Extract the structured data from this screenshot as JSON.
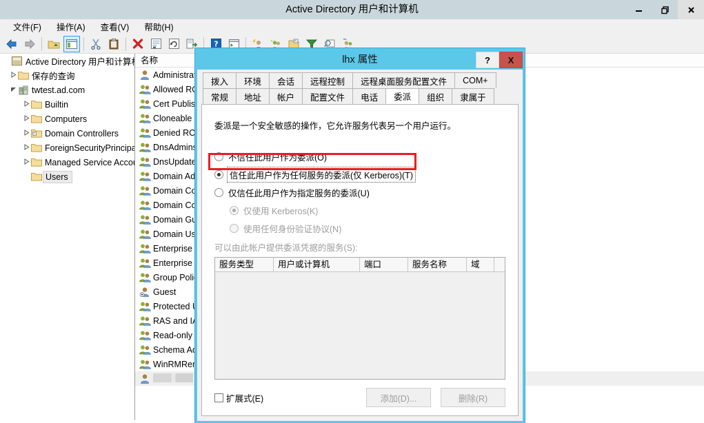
{
  "window": {
    "title": "Active Directory 用户和计算机",
    "controls": {
      "minimize": "minimize-icon",
      "restore": "restore-icon",
      "close": "close-icon"
    }
  },
  "menu": {
    "items": [
      "文件(F)",
      "操作(A)",
      "查看(V)",
      "帮助(H)"
    ]
  },
  "toolbar": {
    "buttons": [
      "back-arrow-icon",
      "forward-arrow-icon",
      "up-folder-icon",
      "show-hide-tree-icon",
      "cut-icon",
      "paste-icon",
      "delete-icon",
      "properties-icon",
      "refresh-icon",
      "export-list-icon",
      "help-icon",
      "run-console-icon",
      "new-user-icon",
      "new-group-icon",
      "new-ou-icon",
      "filter-icon",
      "find-icon",
      "add-member-icon"
    ]
  },
  "tree": {
    "items": [
      {
        "label": "Active Directory 用户和计算机",
        "icon": "console-root-icon",
        "indent": 0,
        "arrow": "",
        "selected": false
      },
      {
        "label": "保存的查询",
        "icon": "folder-icon",
        "indent": 1,
        "arrow": "collapsed",
        "selected": false
      },
      {
        "label": "twtest.ad.com",
        "icon": "domain-icon",
        "indent": 1,
        "arrow": "expanded",
        "selected": false
      },
      {
        "label": "Builtin",
        "icon": "folder-icon",
        "indent": 2,
        "arrow": "collapsed",
        "selected": false
      },
      {
        "label": "Computers",
        "icon": "folder-icon",
        "indent": 2,
        "arrow": "collapsed",
        "selected": false
      },
      {
        "label": "Domain Controllers",
        "icon": "ou-folder-icon",
        "indent": 2,
        "arrow": "collapsed",
        "selected": false
      },
      {
        "label": "ForeignSecurityPrincipals",
        "icon": "folder-icon",
        "indent": 2,
        "arrow": "collapsed",
        "selected": false
      },
      {
        "label": "Managed Service Accounts",
        "icon": "folder-icon",
        "indent": 2,
        "arrow": "collapsed",
        "selected": false
      },
      {
        "label": "Users",
        "icon": "folder-icon",
        "indent": 2,
        "arrow": "",
        "selected": true
      }
    ]
  },
  "list": {
    "header": "名称",
    "rows": [
      {
        "label": "Administrator",
        "icon": "user-icon"
      },
      {
        "label": "Allowed RODC Password Replication Group",
        "icon": "group-icon"
      },
      {
        "label": "Cert Publishers",
        "icon": "group-icon"
      },
      {
        "label": "Cloneable Domain Controllers",
        "icon": "group-icon"
      },
      {
        "label": "Denied RODC Password Replication Group",
        "icon": "group-icon"
      },
      {
        "label": "DnsAdmins",
        "icon": "group-icon"
      },
      {
        "label": "DnsUpdateProxy",
        "icon": "group-icon"
      },
      {
        "label": "Domain Admins",
        "icon": "group-icon"
      },
      {
        "label": "Domain Computers",
        "icon": "group-icon"
      },
      {
        "label": "Domain Controllers",
        "icon": "group-icon"
      },
      {
        "label": "Domain Guests",
        "icon": "group-icon"
      },
      {
        "label": "Domain Users",
        "icon": "group-icon"
      },
      {
        "label": "Enterprise Admins",
        "icon": "group-icon"
      },
      {
        "label": "Enterprise Read-only Domain Controllers",
        "icon": "group-icon"
      },
      {
        "label": "Group Policy Creator Owners",
        "icon": "group-icon"
      },
      {
        "label": "Guest",
        "icon": "user-disabled-icon"
      },
      {
        "label": "Protected Users",
        "icon": "group-icon"
      },
      {
        "label": "RAS and IAS Servers",
        "icon": "group-icon"
      },
      {
        "label": "Read-only Domain Controllers",
        "icon": "group-icon"
      },
      {
        "label": "Schema Admins",
        "icon": "group-icon"
      },
      {
        "label": "WinRMRemoteWMIUsers__",
        "icon": "group-icon"
      },
      {
        "label": "",
        "icon": "user-icon",
        "redacted": true,
        "selected": true
      }
    ]
  },
  "dialog": {
    "title": "lhx 属性",
    "help_label": "?",
    "close_label": "X",
    "tabs_row1": [
      "拨入",
      "环境",
      "会话",
      "远程控制",
      "远程桌面服务配置文件",
      "COM+"
    ],
    "tabs_row2": [
      "常规",
      "地址",
      "帐户",
      "配置文件",
      "电话",
      "委派",
      "组织",
      "隶属于"
    ],
    "active_tab": "委派",
    "delegation": {
      "description": "委派是一个安全敏感的操作，它允许服务代表另一个用户运行。",
      "option_none": "不信任此用户作为委派(O)",
      "option_any": "信任此用户作为任何服务的委派(仅 Kerberos)(T)",
      "option_specified": "仅信任此用户作为指定服务的委派(U)",
      "selected_option": "option_any",
      "sub_kerberos_only": "仅使用 Kerberos(K)",
      "sub_any_protocol": "使用任何身份验证协议(N)",
      "sub_selected": "sub_kerberos_only",
      "services_label": "可以由此帐户提供委派凭据的服务(S):",
      "table_headers": [
        "服务类型",
        "用户或计算机",
        "端口",
        "服务名称",
        "域"
      ],
      "table_rows": [],
      "expanded_checkbox": "扩展式(E)",
      "expanded_checked": false,
      "add_button": "添加(D)...",
      "remove_button": "删除(R)"
    }
  },
  "colors": {
    "dialog_border": "#5bc8ea",
    "highlight_red": "#ee1c1c",
    "close_red": "#c7534c",
    "titlebar": "#c9d7dc"
  }
}
